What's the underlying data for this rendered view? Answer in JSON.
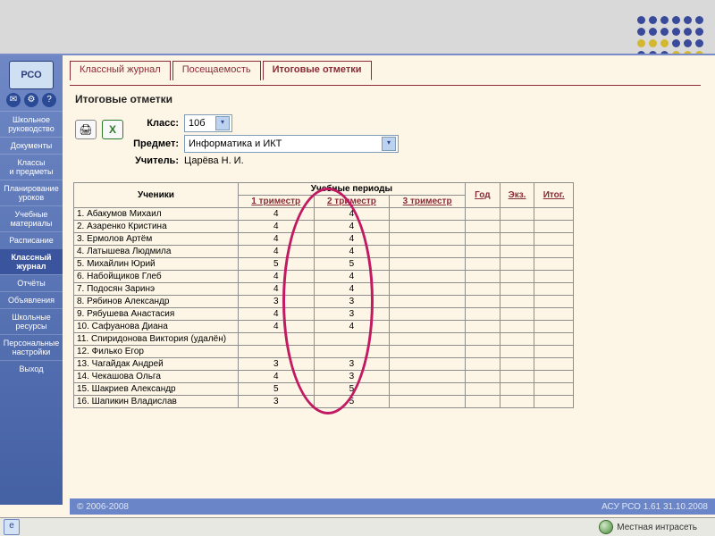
{
  "decor_dots": 24,
  "logo_text": "РСО",
  "sidebar_icons": [
    "✉",
    "⚙",
    "?"
  ],
  "nav": [
    {
      "label": "Школьное\nруководство",
      "active": false
    },
    {
      "label": "Документы",
      "active": false
    },
    {
      "label": "Классы\nи предметы",
      "active": false
    },
    {
      "label": "Планирование\nуроков",
      "active": false
    },
    {
      "label": "Учебные\nматериалы",
      "active": false
    },
    {
      "label": "Расписание",
      "active": false
    },
    {
      "label": "Классный\nжурнал",
      "active": true
    },
    {
      "label": "Отчёты",
      "active": false
    },
    {
      "label": "Объявления",
      "active": false
    },
    {
      "label": "Школьные\nресурсы",
      "active": false
    },
    {
      "label": "Персональные\nнастройки",
      "active": false
    },
    {
      "label": "Выход",
      "active": false
    }
  ],
  "tabs": [
    {
      "label": "Классный журнал",
      "active": false
    },
    {
      "label": "Посещаемость",
      "active": false
    },
    {
      "label": "Итоговые отметки",
      "active": true
    }
  ],
  "page_title": "Итоговые отметки",
  "form": {
    "class_label": "Класс:",
    "class_value": "10б",
    "subject_label": "Предмет:",
    "subject_value": "Информатика и ИКТ",
    "teacher_label": "Учитель:",
    "teacher_value": "Царёва Н. И."
  },
  "action_icons": {
    "print": "🖨",
    "export": "X"
  },
  "table": {
    "col_students": "Ученики",
    "col_periods": "Учебные периоды",
    "col_t1": "1 триместр",
    "col_t2": "2 триместр",
    "col_t3": "3 триместр",
    "col_year": "Год",
    "col_exam": "Экз.",
    "col_final": "Итог."
  },
  "students": [
    {
      "n": "1",
      "name": "Абакумов Михаил",
      "t1": "4",
      "t2": "4",
      "t3": "",
      "y": "",
      "e": "",
      "f": ""
    },
    {
      "n": "2",
      "name": "Азаренко Кристина",
      "t1": "4",
      "t2": "4",
      "t3": "",
      "y": "",
      "e": "",
      "f": ""
    },
    {
      "n": "3",
      "name": "Ермолов Артём",
      "t1": "4",
      "t2": "4",
      "t3": "",
      "y": "",
      "e": "",
      "f": ""
    },
    {
      "n": "4",
      "name": "Латышева Людмила",
      "t1": "4",
      "t2": "4",
      "t3": "",
      "y": "",
      "e": "",
      "f": ""
    },
    {
      "n": "5",
      "name": "Михайлин Юрий",
      "t1": "5",
      "t2": "5",
      "t3": "",
      "y": "",
      "e": "",
      "f": ""
    },
    {
      "n": "6",
      "name": "Набойщиков Глеб",
      "t1": "4",
      "t2": "4",
      "t3": "",
      "y": "",
      "e": "",
      "f": ""
    },
    {
      "n": "7",
      "name": "Подосян Заринэ",
      "t1": "4",
      "t2": "4",
      "t3": "",
      "y": "",
      "e": "",
      "f": ""
    },
    {
      "n": "8",
      "name": "Рябинов Александр",
      "t1": "3",
      "t2": "3",
      "t3": "",
      "y": "",
      "e": "",
      "f": ""
    },
    {
      "n": "9",
      "name": "Рябушева Анастасия",
      "t1": "4",
      "t2": "3",
      "t3": "",
      "y": "",
      "e": "",
      "f": ""
    },
    {
      "n": "10",
      "name": "Сафуанова Диана",
      "t1": "4",
      "t2": "4",
      "t3": "",
      "y": "",
      "e": "",
      "f": ""
    },
    {
      "n": "11",
      "name": "Спиридонова Виктория (удалён)",
      "t1": "",
      "t2": "",
      "t3": "",
      "y": "",
      "e": "",
      "f": ""
    },
    {
      "n": "12",
      "name": "Филько Егор",
      "t1": "",
      "t2": "",
      "t3": "",
      "y": "",
      "e": "",
      "f": ""
    },
    {
      "n": "13",
      "name": "Чагайдак Андрей",
      "t1": "3",
      "t2": "3",
      "t3": "",
      "y": "",
      "e": "",
      "f": ""
    },
    {
      "n": "14",
      "name": "Чекашова Ольга",
      "t1": "4",
      "t2": "3",
      "t3": "",
      "y": "",
      "e": "",
      "f": ""
    },
    {
      "n": "15",
      "name": "Шакриев Александр",
      "t1": "5",
      "t2": "5",
      "t3": "",
      "y": "",
      "e": "",
      "f": ""
    },
    {
      "n": "16",
      "name": "Шапикин Владислав",
      "t1": "3",
      "t2": "5",
      "t3": "",
      "y": "",
      "e": "",
      "f": ""
    }
  ],
  "footer": {
    "copyright": "© 2006-2008",
    "version": "АСУ РСО 1.61   31.10.2008"
  },
  "statusbar": {
    "done_icon": "e",
    "zone_text": "Местная интрасеть"
  }
}
